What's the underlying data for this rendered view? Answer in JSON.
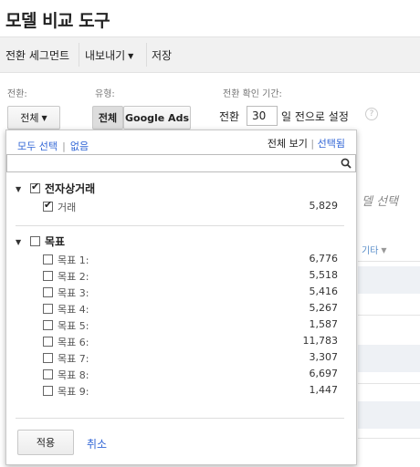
{
  "page": {
    "title": "모델 비교 도구"
  },
  "toolbar": {
    "conversion_segments": "전환 세그먼트",
    "export": "내보내기",
    "save": "저장"
  },
  "controls": {
    "conversion_label": "전환:",
    "conversion_value": "전체",
    "type_label": "유형:",
    "type_all": "전체",
    "type_google_ads": "Google Ads",
    "lookback_label": "전환 확인 기간:",
    "lookback_prefix": "전환",
    "lookback_days": "30",
    "lookback_suffix": "일 전으로 설정"
  },
  "background": {
    "heading": "델 선택",
    "column_other": "기타"
  },
  "dropdown": {
    "select_all": "모두 선택",
    "none": "없음",
    "view_all": "전체 보기",
    "view_selected": "선택됨",
    "groups": [
      {
        "name": "전자상거래",
        "checked": true,
        "items": [
          {
            "label": "거래",
            "value": "5,829",
            "checked": true
          }
        ]
      },
      {
        "name": "목표",
        "checked": false,
        "items": [
          {
            "label": "목표 1:",
            "value": "6,776",
            "checked": false
          },
          {
            "label": "목표 2:",
            "value": "5,518",
            "checked": false
          },
          {
            "label": "목표 3:",
            "value": "5,416",
            "checked": false
          },
          {
            "label": "목표 4:",
            "value": "5,267",
            "checked": false
          },
          {
            "label": "목표 5:",
            "value": "1,587",
            "checked": false
          },
          {
            "label": "목표 6:",
            "value": "11,783",
            "checked": false
          },
          {
            "label": "목표 7:",
            "value": "3,307",
            "checked": false
          },
          {
            "label": "목표 8:",
            "value": "6,697",
            "checked": false
          },
          {
            "label": "목표 9:",
            "value": "1,447",
            "checked": false
          }
        ]
      }
    ],
    "apply": "적용",
    "cancel": "취소"
  },
  "colors": {
    "link": "#3367d6",
    "toolbar_bg": "#f1f1f1"
  }
}
